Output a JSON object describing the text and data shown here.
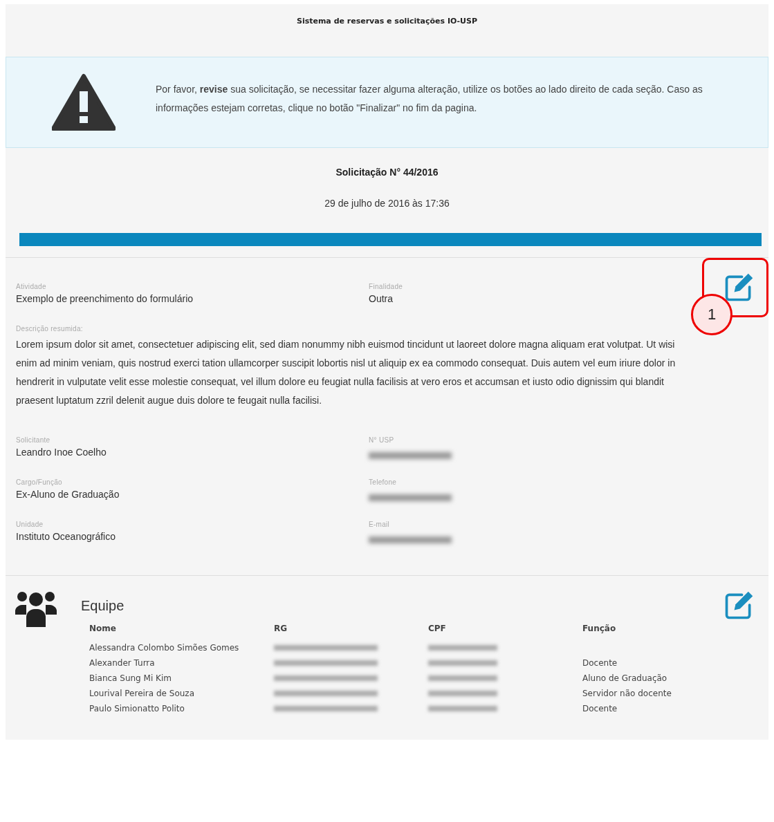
{
  "header": {
    "title": "Sistema de reservas e solicitações IO-USP"
  },
  "alert": {
    "text": "Por favor, **revise** sua solicitação, se necessitar fazer alguma alteração, utilize os botões ao lado direito de cada seção. Caso as informações estejam corretas, clique no botão \"Finalizar\" no fim da pagina."
  },
  "request": {
    "title": "Solicitação N° 44/2016",
    "date": "29 de julho de 2016 às 17:36",
    "progress": {
      "level": 1
    }
  },
  "details": {
    "fields": [
      {
        "label": "Atividade",
        "value": "Exemplo de preenchimento do formulário"
      },
      {
        "label": "Finalidade",
        "value": "Outra"
      }
    ],
    "description": {
      "label": "Descrição resumida:",
      "value": "Lorem ipsum dolor sit amet, consectetuer adipiscing elit, sed diam nonummy nibh euismod tincidunt ut laoreet dolore magna aliquam erat volutpat. Ut wisi enim ad minim veniam, quis nostrud exerci tation ullamcorper suscipit lobortis nisl ut aliquip ex ea commodo consequat. Duis autem vel eum iriure dolor in hendrerit in vulputate velit esse molestie consequat, vel illum dolore eu feugiat nulla facilisis at vero eros et accumsan et iusto odio dignissim qui blandit praesent luptatum zzril delenit augue duis dolore te feugait nulla facilisi."
    },
    "applicant": [
      {
        "label": "Solicitante",
        "value": "Leandro Inoe Coelho"
      },
      {
        "label": "N° USP"
      },
      {
        "label": "Cargo/Função",
        "value": "Ex-Aluno de Graduação"
      },
      {
        "label": "Telefone"
      },
      {
        "label": "Unidade",
        "value": "Instituto Oceanográfico"
      },
      {
        "label": "E-mail"
      }
    ],
    "annotation": {
      "label": "1"
    }
  },
  "team": {
    "title": "Equipe",
    "columns": [
      "Nome",
      "RG",
      "CPF",
      "Função"
    ],
    "rows": [
      {
        "name": "Alessandra Colombo Simões Gomes"
      },
      {
        "name": "Alexander Turra",
        "role": "Docente"
      },
      {
        "name": "Bianca Sung Mi Kim",
        "role": "Aluno de Graduação"
      },
      {
        "name": "Lourival Pereira de Souza",
        "role": "Servidor não docente"
      },
      {
        "name": "Paulo Simionatto Polito",
        "role": "Docente"
      }
    ]
  }
}
